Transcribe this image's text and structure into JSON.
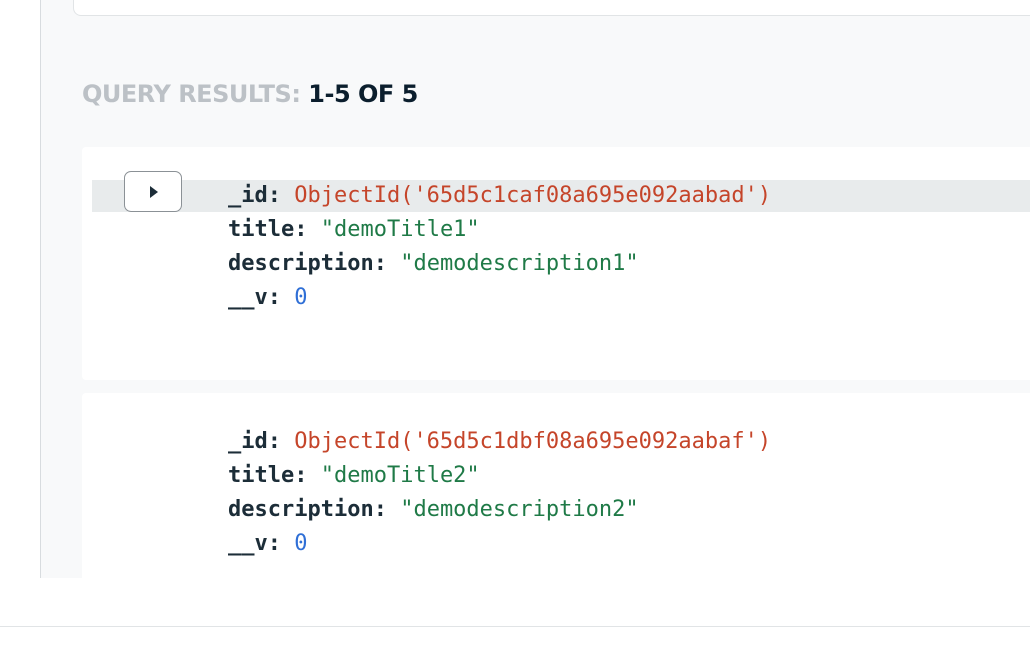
{
  "results": {
    "label": "QUERY RESULTS:",
    "count": "1-5 OF 5"
  },
  "documents": [
    {
      "fields": [
        {
          "key": "_id:",
          "value": "ObjectId('65d5c1caf08a695e092aabad')",
          "kind": "oid"
        },
        {
          "key": "title:",
          "value": "\"demoTitle1\"",
          "kind": "str"
        },
        {
          "key": "description:",
          "value": "\"demodescription1\"",
          "kind": "str"
        },
        {
          "key": "__v:",
          "value": "0",
          "kind": "num"
        }
      ]
    },
    {
      "fields": [
        {
          "key": "_id:",
          "value": "ObjectId('65d5c1dbf08a695e092aabaf')",
          "kind": "oid"
        },
        {
          "key": "title:",
          "value": "\"demoTitle2\"",
          "kind": "str"
        },
        {
          "key": "description:",
          "value": "\"demodescription2\"",
          "kind": "str"
        },
        {
          "key": "__v:",
          "value": "0",
          "kind": "num"
        }
      ]
    }
  ],
  "icons": {
    "expand": "play-icon"
  },
  "colors": {
    "key": "#1c2d38",
    "objectid": "#c5452a",
    "string": "#1f7a47",
    "number": "#2f6fd6",
    "header_label": "#bcc1c6",
    "header_count": "#0b1e2d"
  }
}
